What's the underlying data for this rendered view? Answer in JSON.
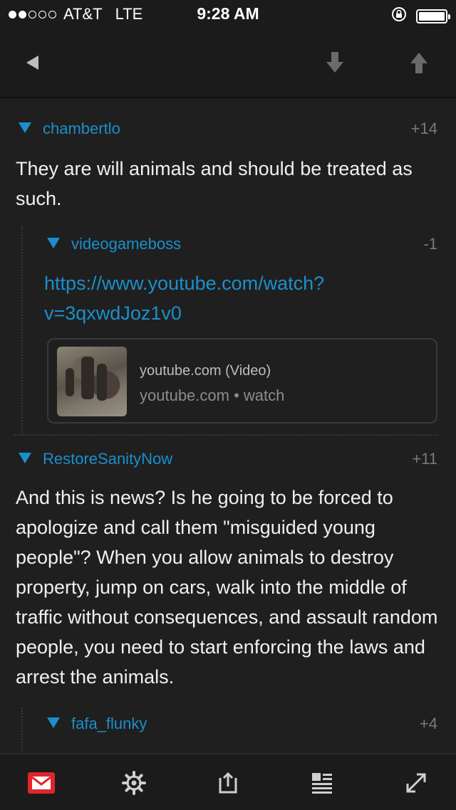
{
  "status_bar": {
    "carrier": "AT&T",
    "network": "LTE",
    "time": "9:28 AM",
    "signal_bars_filled": 2,
    "signal_bars_total": 5,
    "battery_level": 1.0
  },
  "nav": {
    "back_icon": "back-triangle-icon",
    "downvote_icon": "arrow-down-icon",
    "upvote_icon": "arrow-up-icon"
  },
  "comments": [
    {
      "author": "chambertlo",
      "score": "+14",
      "text": "They are will animals and should be treated as such."
    },
    {
      "author": "videogameboss",
      "score": "-1",
      "link": "https://www.youtube.com/watch?v=3qxwdJoz1v0",
      "preview": {
        "title": "youtube.com (Video)",
        "subtitle": "youtube.com • watch"
      }
    },
    {
      "author": "RestoreSanityNow",
      "score": "+11",
      "text": "And this is news?  Is he going to be forced to apologize and call them \"misguided young people\"?  When you allow animals to destroy property, jump on cars, walk into the middle of traffic without consequences, and assault random people, you need to start enforcing the laws and arrest the animals."
    },
    {
      "author": "fafa_flunky",
      "score": "+4"
    }
  ],
  "tab_bar": {
    "items": [
      "mail-icon",
      "gear-icon",
      "share-icon",
      "reader-icon",
      "expand-icon"
    ],
    "accent": "#e0262b"
  },
  "colors": {
    "background": "#1f1f1f",
    "link_blue": "#1b8fcb",
    "score_gray": "#7a7a7a"
  }
}
